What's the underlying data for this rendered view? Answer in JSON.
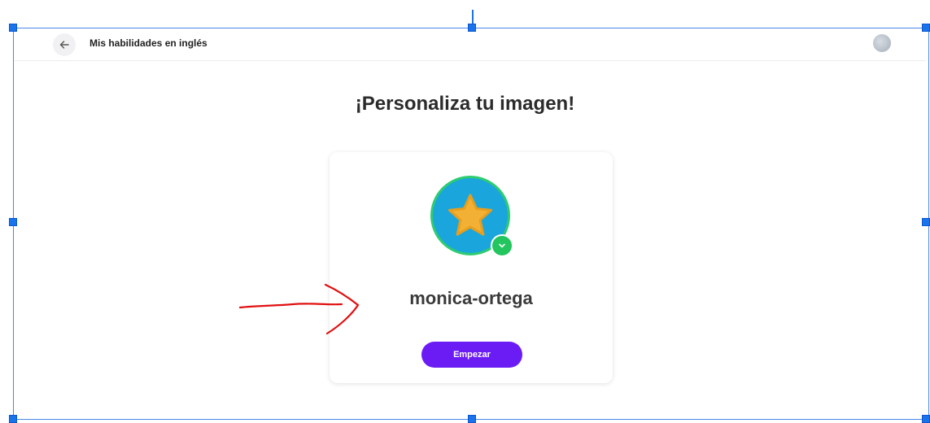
{
  "header": {
    "back_icon": "arrow-left-icon",
    "title": "Mis habilidades en inglés",
    "avatar_icon": "user-avatar-icon"
  },
  "main": {
    "title": "¡Personaliza tu imagen!",
    "card": {
      "avatar_icon": "star-icon",
      "badge_icon": "chevron-down-icon",
      "username": "monica-ortega",
      "button_label": "Empezar"
    }
  },
  "annotation": {
    "type": "red-hand-drawn-arrow"
  },
  "colors": {
    "accent": "#6b1cf5",
    "avatar_bg": "#1aa6dc",
    "avatar_ring": "#2ecc71",
    "star": "#f2b134",
    "selection": "#1a73e8",
    "annotation": "#e01010"
  }
}
